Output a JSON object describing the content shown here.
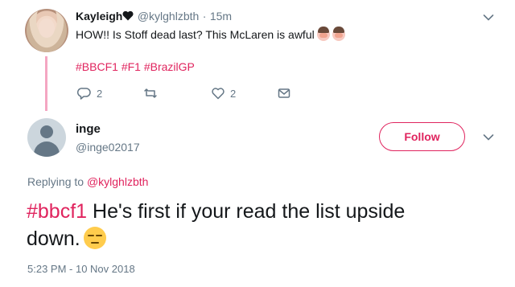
{
  "parent_tweet": {
    "display_name": "Kayleigh",
    "handle": "@kylghlzbth",
    "separator": "·",
    "time_ago": "15m",
    "text": "HOW!! Is Stoff dead last? This McLaren is awful",
    "hashtags": [
      "#BBCF1",
      "#F1",
      "#BrazilGP"
    ],
    "actions": {
      "reply_count": "2",
      "retweet_count": "",
      "like_count": "2"
    }
  },
  "reply_tweet": {
    "display_name": "inge",
    "handle": "@inge02017",
    "follow_label": "Follow",
    "replying_to_label": "Replying to",
    "replying_to_handle": "@kylghlzbth",
    "hashtag": "#bbcf1",
    "text_line1": " He's first if your read the list upside",
    "text_line2": "down.",
    "timestamp": "5:23 PM - 10 Nov 2018"
  },
  "colors": {
    "accent": "#e0245e",
    "muted": "#657786",
    "thread_line": "#f4a6c2"
  },
  "icons": [
    "heart-icon",
    "facepalm-emoji",
    "reply-icon",
    "retweet-icon",
    "like-icon",
    "message-icon",
    "chevron-down-icon",
    "unamused-emoji",
    "default-avatar"
  ]
}
